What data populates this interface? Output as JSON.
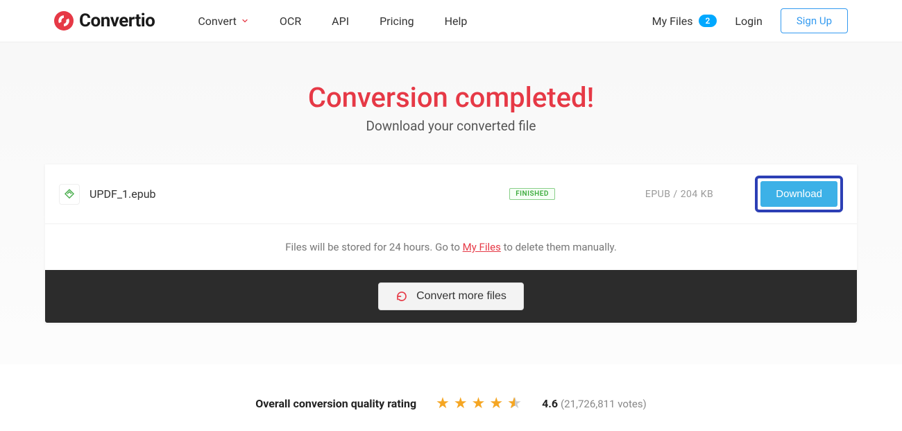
{
  "brand": "Convertio",
  "nav": {
    "convert": "Convert",
    "ocr": "OCR",
    "api": "API",
    "pricing": "Pricing",
    "help": "Help"
  },
  "header_right": {
    "my_files": "My Files",
    "my_files_count": "2",
    "login": "Login",
    "signup": "Sign Up"
  },
  "main": {
    "title": "Conversion completed!",
    "subtitle": "Download your converted file"
  },
  "file": {
    "name": "UPDF_1.epub",
    "status": "FINISHED",
    "format": "EPUB",
    "size": "204 KB",
    "download_label": "Download"
  },
  "note": {
    "prefix": "Files will be stored for 24 hours. Go to ",
    "link": "My Files",
    "suffix": " to delete them manually."
  },
  "convert_more": "Convert more files",
  "rating": {
    "label": "Overall conversion quality rating",
    "value": "4.6",
    "votes": "(21,726,811 votes)"
  }
}
